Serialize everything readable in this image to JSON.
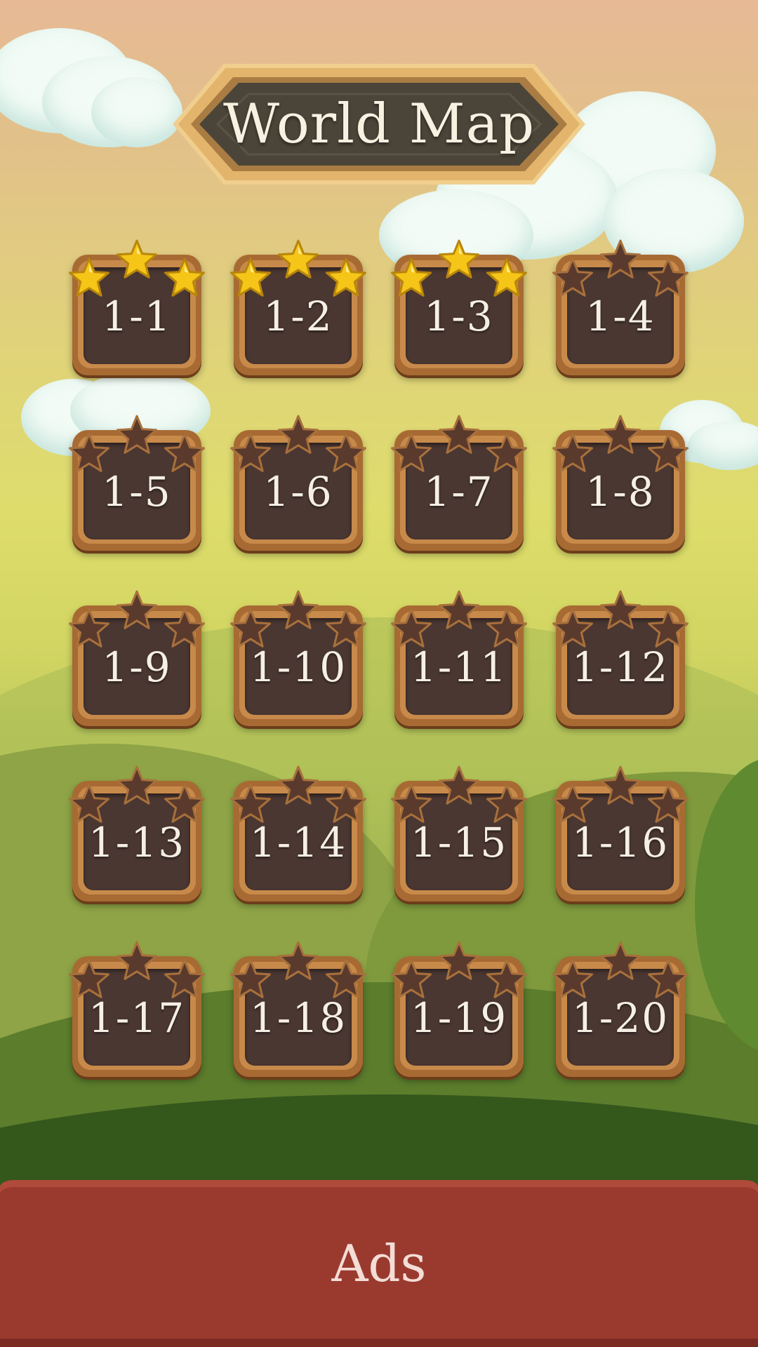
{
  "header": {
    "title": "World Map"
  },
  "colors": {
    "star_earned": "#f5c518",
    "star_empty": "#5a3a2c",
    "tile_frame": "#a86a33",
    "tile_inner": "#4a3732",
    "ads_bar": "#9a3a2e"
  },
  "levels": [
    {
      "label": "1-1",
      "stars": 3
    },
    {
      "label": "1-2",
      "stars": 3
    },
    {
      "label": "1-3",
      "stars": 3
    },
    {
      "label": "1-4",
      "stars": 0
    },
    {
      "label": "1-5",
      "stars": 0
    },
    {
      "label": "1-6",
      "stars": 0
    },
    {
      "label": "1-7",
      "stars": 0
    },
    {
      "label": "1-8",
      "stars": 0
    },
    {
      "label": "1-9",
      "stars": 0
    },
    {
      "label": "1-10",
      "stars": 0
    },
    {
      "label": "1-11",
      "stars": 0
    },
    {
      "label": "1-12",
      "stars": 0
    },
    {
      "label": "1-13",
      "stars": 0
    },
    {
      "label": "1-14",
      "stars": 0
    },
    {
      "label": "1-15",
      "stars": 0
    },
    {
      "label": "1-16",
      "stars": 0
    },
    {
      "label": "1-17",
      "stars": 0
    },
    {
      "label": "1-18",
      "stars": 0
    },
    {
      "label": "1-19",
      "stars": 0
    },
    {
      "label": "1-20",
      "stars": 0
    }
  ],
  "ads": {
    "label": "Ads"
  }
}
